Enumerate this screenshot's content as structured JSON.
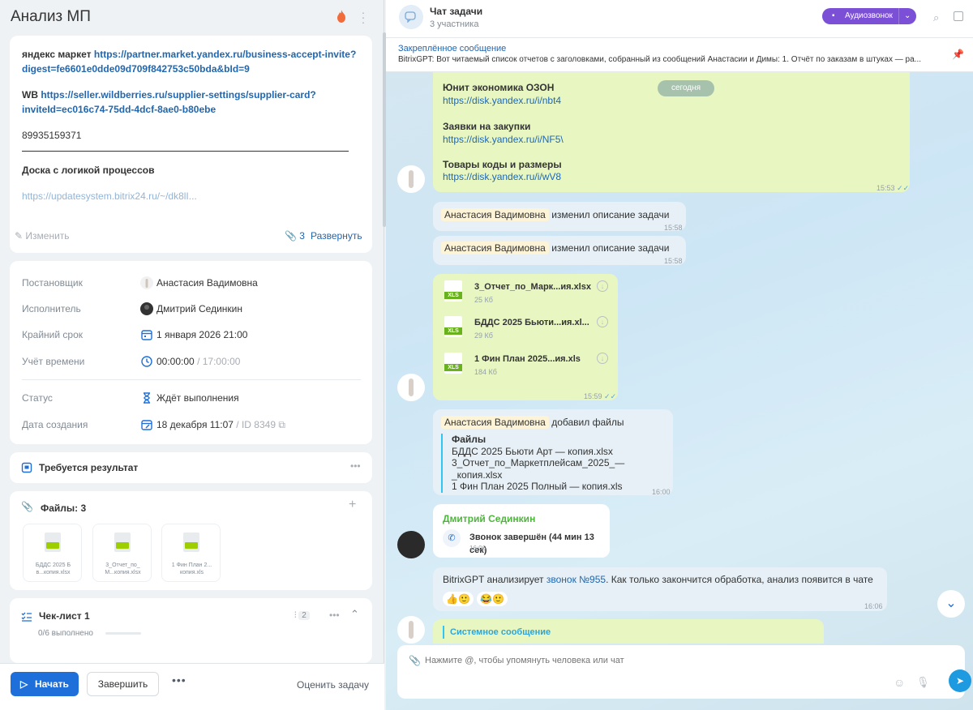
{
  "task": {
    "title": "Анализ МП",
    "description": {
      "yandex_label": "яндекс маркет",
      "yandex_link_1": "https://partner.market.yandex.ru/business-accept-invite?",
      "yandex_link_2": "digest=fe6601e0dde09d709f842753c50bda&bId=9",
      "wb_label": "WB",
      "wb_link_1": "https://seller.wildberries.ru/supplier-settings/supplier-card?",
      "wb_link_2": "inviteId=ec016c74-75dd-4dcf-8ae0-b80ebe",
      "phone": "89935159371",
      "board_label": "Доска с логикой процессов",
      "board_link": "https://updatesystem.bitrix24.ru/~/dk8lI..."
    },
    "edit_label": "Изменить",
    "attach_count": "3",
    "expand_label": "Развернуть"
  },
  "props": {
    "creator_label": "Постановщик",
    "creator": "Анастасия Вадимовна",
    "assignee_label": "Исполнитель",
    "assignee": "Дмитрий Сединкин",
    "deadline_label": "Крайний срок",
    "deadline": "1 января 2026 21:00",
    "time_label": "Учёт времени",
    "time_spent": "00:00:00",
    "time_sep": "/",
    "time_plan": "17:00:00",
    "status_label": "Статус",
    "status": "Ждёт выполнения",
    "created_label": "Дата создания",
    "created": "18 декабря 11:07",
    "id_sep": "/",
    "id": "ID 8349"
  },
  "result": {
    "label": "Требуется результат"
  },
  "files": {
    "label": "Файлы: 3",
    "items": [
      {
        "name": "БДДС 2025 Б в...копия.xlsx"
      },
      {
        "name": "3_Отчет_по_ М...копия.xlsx"
      },
      {
        "name": "1 Фин План 2... копия.xls"
      }
    ]
  },
  "checklist": {
    "label": "Чек-лист 1",
    "count": "2",
    "progress": "0/6 выполнено",
    "done": 0,
    "total": 6
  },
  "actions": {
    "start": "Начать",
    "finish": "Завершить",
    "rate": "Оценить задачу"
  },
  "chat": {
    "title": "Чат задачи",
    "subtitle": "3 участника",
    "call": "Аудиозвонок",
    "pinned_title": "Закреплённое сообщение",
    "pinned_text": "BitrixGPT: Вот читаемый список отчетов с заголовками, собранный из сообщений Анастасии и Димы: 1. Отчёт по заказам в штуках — ра...",
    "today": "сегодня",
    "msg1": {
      "t1": "Юнит экономика ОЗОН",
      "l1": "https://disk.yandex.ru/i/nbt4",
      "t2": "Заявки на закупки",
      "l2": "https://disk.yandex.ru/i/NF5\\",
      "t3": "Товары коды и размеры",
      "l3": "https://disk.yandex.ru/i/wV8",
      "time": "15:53"
    },
    "sys1": {
      "who": "Анастасия Вадимовна",
      "text": "изменил описание задачи",
      "time": "15:58"
    },
    "sys2": {
      "who": "Анастасия Вадимовна",
      "text": "изменил описание задачи",
      "time": "15:58"
    },
    "files_msg": {
      "f1": "3_Отчет_по_Марк...ия.xlsx",
      "s1": "25 Кб",
      "f2": "БДДС 2025 Бьюти...ия.xl...",
      "s2": "29 Кб",
      "f3": "1 Фин План 2025...ия.xls",
      "s3": "184 Кб",
      "ext": "XLS",
      "time": "15:59"
    },
    "added": {
      "who": "Анастасия Вадимовна",
      "text": "добавил файлы",
      "head": "Файлы",
      "f1": "БДДС 2025 Бьюти Арт — копия.xlsx",
      "f2": "3_Отчет_по_Маркетплейсам_2025_—_копия.xlsx",
      "f3": "1 Фин План 2025 Полный — копия.xls",
      "time": "16:00"
    },
    "call_msg": {
      "who": "Дмитрий Сединкин",
      "text": "Звонок завершён (44 мин 13 сек)",
      "time": "16:06"
    },
    "gpt": {
      "pre": "BitrixGPT анализирует",
      "link": "звонок №955",
      "post": ". Как только закончится обработка, анализ появится в чате",
      "time": "16:06"
    },
    "system_msg": "Системное сообщение",
    "input_placeholder": "Нажмите @, чтобы упомянуть человека или чат"
  }
}
